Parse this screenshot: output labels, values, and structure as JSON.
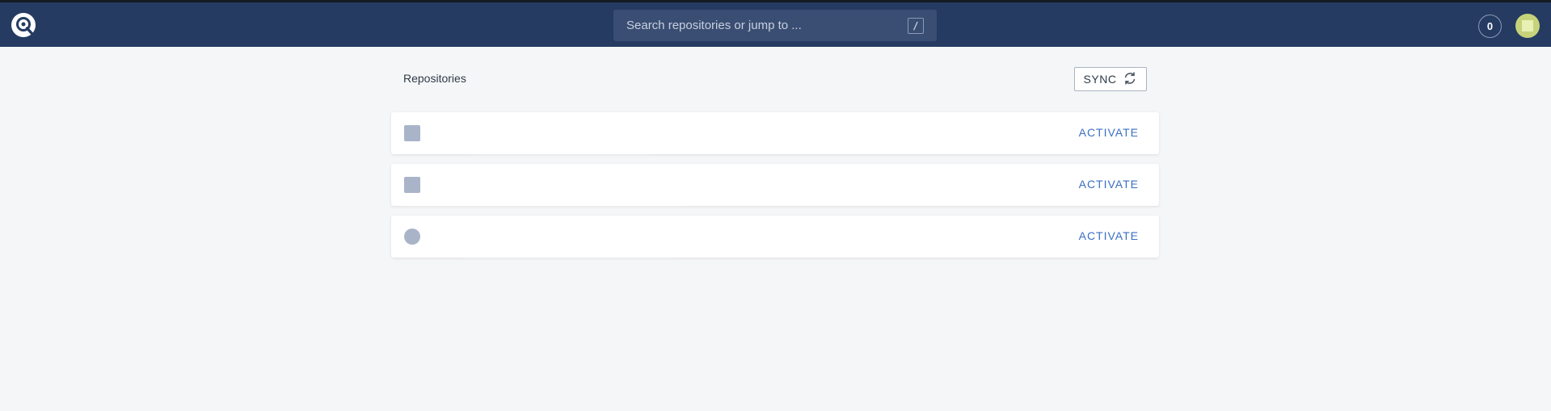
{
  "header": {
    "search": {
      "placeholder": "Search repositories or jump to ...",
      "shortcut": "/"
    },
    "notifications_count": "0"
  },
  "main": {
    "title": "Repositories",
    "sync_label": "SYNC",
    "repositories": [
      {
        "name": "",
        "action": "ACTIVATE"
      },
      {
        "name": "",
        "action": "ACTIVATE"
      },
      {
        "name": "",
        "action": "ACTIVATE"
      }
    ]
  },
  "colors": {
    "header_bg": "#253b62",
    "page_bg": "#f5f6f8",
    "accent": "#3a6fc4"
  },
  "icons": [
    "app-logo-icon",
    "refresh-icon",
    "repo-icon",
    "avatar"
  ]
}
